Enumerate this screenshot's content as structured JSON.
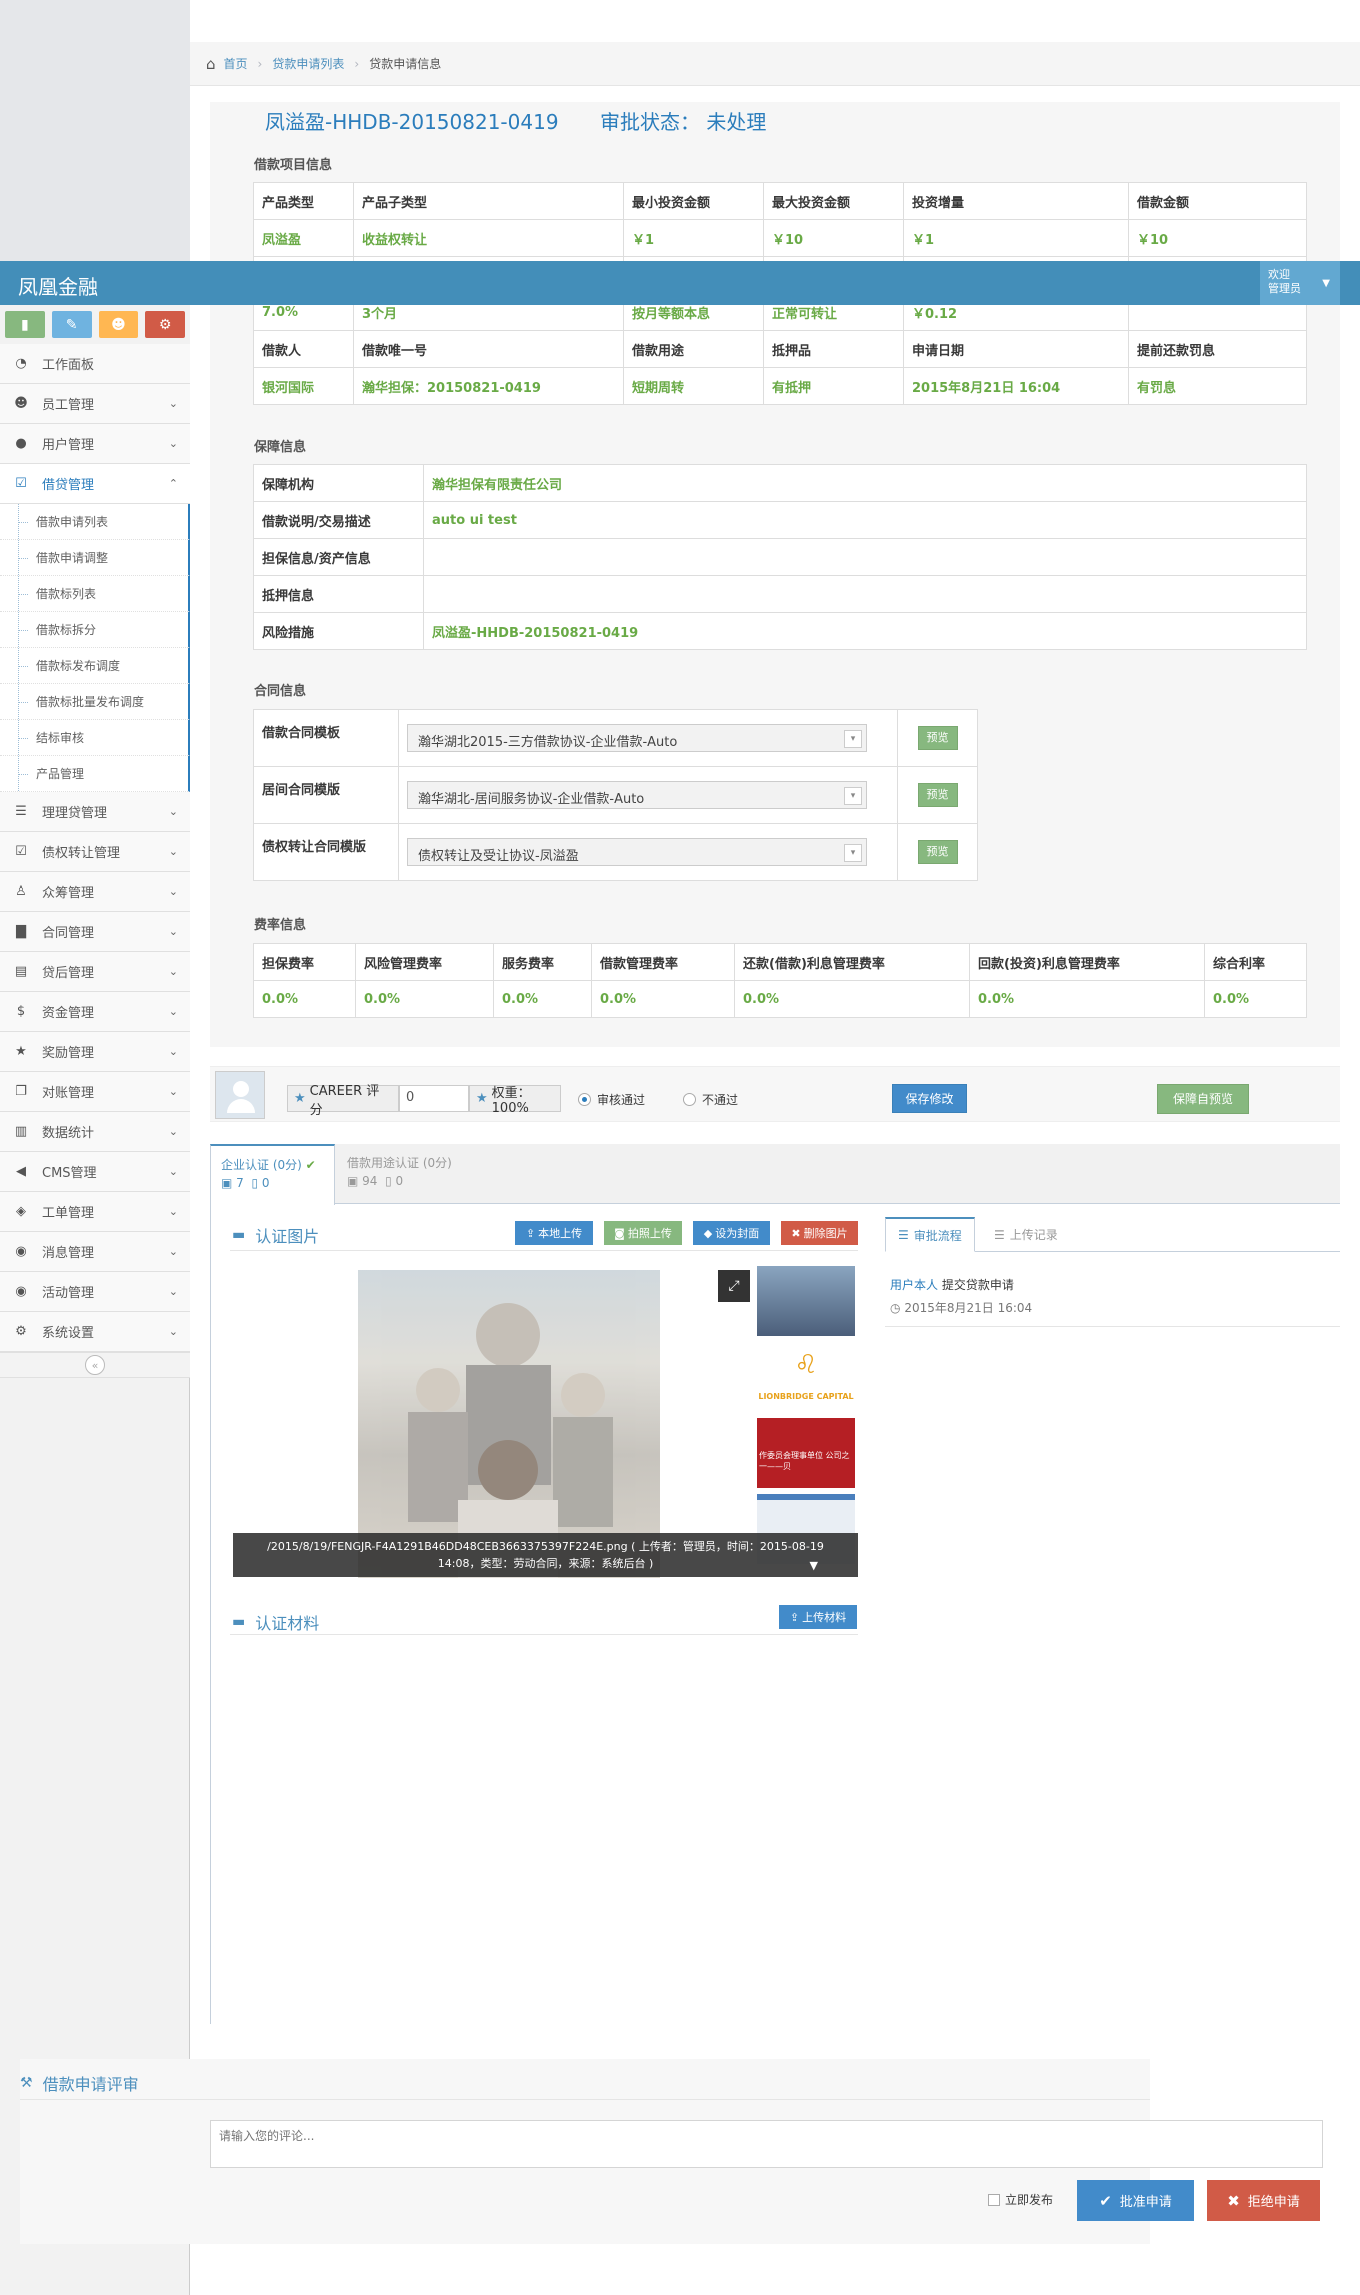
{
  "brand": "凤凰金融",
  "user": {
    "welcome": "欢迎",
    "name": "管理员"
  },
  "shortcuts": [
    {
      "icon": "signal-icon",
      "color": "#87b87f"
    },
    {
      "icon": "pencil-icon",
      "color": "#6fb3e0"
    },
    {
      "icon": "users-icon",
      "color": "#ffb752"
    },
    {
      "icon": "cogs-icon",
      "color": "#d15b47"
    }
  ],
  "nav": {
    "items_before": [
      {
        "label": "工作面板",
        "icon": "tachometer-icon"
      },
      {
        "label": "员工管理",
        "icon": "users-icon"
      },
      {
        "label": "用户管理",
        "icon": "user-icon"
      }
    ],
    "active": {
      "label": "借贷管理",
      "icon": "check-square-icon"
    },
    "sub_items": [
      "借款申请列表",
      "借款申请调整",
      "借款标列表",
      "借款标拆分",
      "借款标发布调度",
      "借款标批量发布调度",
      "结标审核",
      "产品管理"
    ],
    "items_after": [
      {
        "label": "理理贷管理",
        "icon": "list-icon"
      },
      {
        "label": "债权转让管理",
        "icon": "check-square-icon"
      },
      {
        "label": "众筹管理",
        "icon": "male-icon"
      },
      {
        "label": "合同管理",
        "icon": "file-icon"
      },
      {
        "label": "贷后管理",
        "icon": "tasks-icon"
      },
      {
        "label": "资金管理",
        "icon": "dollar-icon"
      },
      {
        "label": "奖励管理",
        "icon": "star-icon"
      },
      {
        "label": "对账管理",
        "icon": "copy-icon"
      },
      {
        "label": "数据统计",
        "icon": "bar-chart-icon"
      },
      {
        "label": "CMS管理",
        "icon": "bullhorn-icon"
      },
      {
        "label": "工单管理",
        "icon": "ticket-icon"
      },
      {
        "label": "消息管理",
        "icon": "comments-icon"
      },
      {
        "label": "活动管理",
        "icon": "comments-icon"
      },
      {
        "label": "系统设置",
        "icon": "cogs-icon"
      }
    ]
  },
  "breadcrumb": {
    "home": "首页",
    "list": "贷款申请列表",
    "current": "贷款申请信息"
  },
  "loan": {
    "title": "凤溢盈-HHDB-20150821-0419",
    "status_label": "审批状态：",
    "status": "未处理"
  },
  "project": {
    "label": "借款项目信息",
    "row1_headers": [
      "产品类型",
      "产品子类型",
      "最小投资金额",
      "最大投资金额",
      "投资增量",
      "借款金额"
    ],
    "row1_values": [
      "凤溢盈",
      "收益权转让",
      "￥1",
      "￥10",
      "￥1",
      "￥10"
    ],
    "row2_values": [
      "7.0%",
      "3个月",
      "按月等额本息",
      "正常可转让",
      "￥0.12",
      ""
    ],
    "row3_headers": [
      "借款人",
      "借款唯一号",
      "借款用途",
      "抵押品",
      "申请日期",
      "提前还款罚息"
    ],
    "row3_values": [
      "银河国际",
      "瀚华担保：20150821-0419",
      "短期周转",
      "有抵押",
      "2015年8月21日 16:04",
      "有罚息"
    ]
  },
  "guarantee": {
    "label": "保障信息",
    "rows": [
      {
        "k": "保障机构",
        "v": "瀚华担保有限责任公司"
      },
      {
        "k": "借款说明/交易描述",
        "v": "auto ui test"
      },
      {
        "k": "担保信息/资产信息",
        "v": ""
      },
      {
        "k": "抵押信息",
        "v": ""
      },
      {
        "k": "风险措施",
        "v": "凤溢盈-HHDB-20150821-0419"
      }
    ]
  },
  "contracts": {
    "label": "合同信息",
    "preview": "预览",
    "rows": [
      {
        "k": "借款合同模板",
        "v": "瀚华湖北2015-三方借款协议-企业借款-Auto"
      },
      {
        "k": "居间合同模版",
        "v": "瀚华湖北-居间服务协议-企业借款-Auto"
      },
      {
        "k": "债权转让合同模版",
        "v": "债权转让及受让协议-凤溢盈"
      }
    ]
  },
  "fees": {
    "label": "费率信息",
    "headers": [
      "担保费率",
      "风险管理费率",
      "服务费率",
      "借款管理费率",
      "还款(借款)利息管理费率",
      "回款(投资)利息管理费率",
      "综合利率"
    ],
    "values": [
      "0.0%",
      "0.0%",
      "0.0%",
      "0.0%",
      "0.0%",
      "0.0%",
      "0.0%"
    ]
  },
  "review": {
    "career_label": "CAREER 评分",
    "career_value": "0",
    "weight": "权重：100%",
    "pass": "审核通过",
    "fail": "不通过",
    "save": "保存修改",
    "guarantor_preview": "保障自预览"
  },
  "cert_tabs": [
    {
      "label": "企业认证 (0分)",
      "images": "7",
      "files": "0"
    },
    {
      "label": "借款用途认证 (0分)",
      "images": "94",
      "files": "0"
    }
  ],
  "cert_images": {
    "title": "认证图片",
    "btn_local": "本地上传",
    "btn_photo": "拍照上传",
    "btn_cover": "设为封面",
    "btn_delete": "删除图片",
    "caption": "/2015/8/19/FENGJR-F4A1291B46DD48CEB3663375397F224E.png ( 上传者：管理员，时间：2015-08-19 14:08，类型：劳动合同，来源：系统后台 )",
    "thumb2_text": "LIONBRIDGE CAPITAL",
    "thumb3_text": "作委员会理事单位 公司之一——贝"
  },
  "cert_materials": {
    "title": "认证材料",
    "btn_upload": "上传材料"
  },
  "flow": {
    "tab_active": "审批流程",
    "tab_inactive": "上传记录",
    "entry_user": "用户本人",
    "entry_action": "提交贷款申请",
    "entry_time": "2015年8月21日 16:04"
  },
  "comment": {
    "title": "借款申请评审",
    "placeholder": "请输入您的评论...",
    "publish": "立即发布",
    "approve": "批准申请",
    "reject": "拒绝申请"
  }
}
